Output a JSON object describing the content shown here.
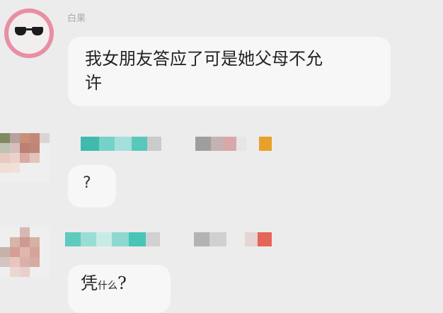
{
  "messages": [
    {
      "sender": "白果",
      "text_line1": "我女朋友答应了可是她父母不允",
      "text_line2": "许"
    },
    {
      "sender": "",
      "text": "?"
    },
    {
      "sender": "",
      "text_big": "凭",
      "text_small": "什么",
      "text_end": "?"
    }
  ],
  "icons": {
    "avatar_1": "cat-sunglasses-avatar-icon",
    "avatar_2": "pixelated-avatar-icon",
    "avatar_3": "pixelated-avatar-icon"
  },
  "colors": {
    "background": "#ececec",
    "bubble": "#f7f7f7",
    "avatar_ring": "#e88fa3",
    "avatar_face": "#f2eeed",
    "sender_text": "#aaaaaa",
    "mosaic_orange": "#e7a12a",
    "mosaic_red": "#e46657",
    "mosaic_teal": "#48c5b7"
  }
}
